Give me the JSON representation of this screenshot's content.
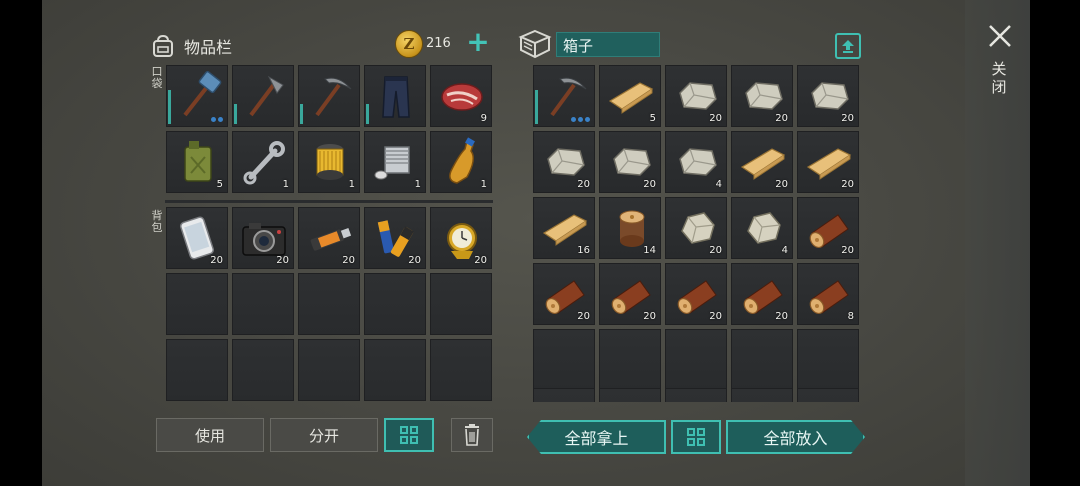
{
  "inventory": {
    "title": "物品栏",
    "coins": "216",
    "pocket_label": "口袋",
    "backpack_label": "背包",
    "pocket_slots": [
      {
        "icon": "sledgehammer-icon",
        "count": "",
        "dur": "tall",
        "dots": 2
      },
      {
        "icon": "hatchet-icon",
        "count": "",
        "dur": "short",
        "dots": 0
      },
      {
        "icon": "pickaxe-icon",
        "count": "",
        "dur": "short",
        "dots": 0
      },
      {
        "icon": "pants-icon",
        "count": "",
        "dur": "short",
        "dots": 0
      },
      {
        "icon": "meat-icon",
        "count": "9",
        "dur": "",
        "dots": 0
      },
      {
        "icon": "jerrycan-icon",
        "count": "5",
        "dur": "",
        "dots": 0
      },
      {
        "icon": "wrench-icon",
        "count": "1",
        "dur": "",
        "dots": 0
      },
      {
        "icon": "filter-icon",
        "count": "1",
        "dur": "",
        "dots": 0
      },
      {
        "icon": "engine-cylinder-icon",
        "count": "1",
        "dur": "",
        "dots": 0
      },
      {
        "icon": "bottle-icon",
        "count": "1",
        "dur": "",
        "dots": 0
      }
    ],
    "backpack_slots": [
      {
        "icon": "phone-icon",
        "count": "20"
      },
      {
        "icon": "camera-icon",
        "count": "20"
      },
      {
        "icon": "usb-drive-icon",
        "count": "20"
      },
      {
        "icon": "batteries-icon",
        "count": "20"
      },
      {
        "icon": "gold-watch-icon",
        "count": "20"
      },
      {
        "icon": "",
        "count": ""
      },
      {
        "icon": "",
        "count": ""
      },
      {
        "icon": "",
        "count": ""
      },
      {
        "icon": "",
        "count": ""
      },
      {
        "icon": "",
        "count": ""
      },
      {
        "icon": "",
        "count": ""
      },
      {
        "icon": "",
        "count": ""
      },
      {
        "icon": "",
        "count": ""
      },
      {
        "icon": "",
        "count": ""
      },
      {
        "icon": "",
        "count": ""
      }
    ],
    "use_button": "使用",
    "split_button": "分开"
  },
  "container": {
    "name": "箱子",
    "slots": [
      {
        "icon": "pickaxe-icon",
        "count": "",
        "dur": "tall",
        "dots": 3
      },
      {
        "icon": "plank-icon",
        "count": "5"
      },
      {
        "icon": "stone-icon",
        "count": "20"
      },
      {
        "icon": "stone-icon",
        "count": "20"
      },
      {
        "icon": "stone-icon",
        "count": "20"
      },
      {
        "icon": "stone-icon",
        "count": "20"
      },
      {
        "icon": "stone-icon",
        "count": "20"
      },
      {
        "icon": "stone-icon",
        "count": "4"
      },
      {
        "icon": "plank-icon",
        "count": "20"
      },
      {
        "icon": "plank-icon",
        "count": "20"
      },
      {
        "icon": "plank-icon",
        "count": "16"
      },
      {
        "icon": "log-stump-icon",
        "count": "14"
      },
      {
        "icon": "rock-icon",
        "count": "20"
      },
      {
        "icon": "rock-icon",
        "count": "4"
      },
      {
        "icon": "log-icon",
        "count": "20"
      },
      {
        "icon": "log-icon",
        "count": "20"
      },
      {
        "icon": "log-icon",
        "count": "20"
      },
      {
        "icon": "log-icon",
        "count": "20"
      },
      {
        "icon": "log-icon",
        "count": "20"
      },
      {
        "icon": "log-icon",
        "count": "8"
      },
      {
        "icon": "",
        "count": ""
      },
      {
        "icon": "",
        "count": ""
      },
      {
        "icon": "",
        "count": ""
      },
      {
        "icon": "",
        "count": ""
      },
      {
        "icon": "",
        "count": ""
      }
    ],
    "take_all_button": "全部拿上",
    "put_all_button": "全部放入"
  },
  "close_label": "关闭",
  "colors": {
    "accent": "#3fbfb2",
    "durability": "#3aa89c",
    "dots": "#3a82c8"
  }
}
